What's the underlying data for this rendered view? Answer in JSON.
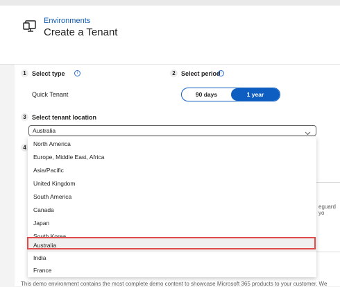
{
  "header": {
    "breadcrumb": "Environments",
    "title": "Create a Tenant"
  },
  "step1": {
    "number": "1",
    "label": "Select type",
    "value": "Quick Tenant"
  },
  "step2": {
    "number": "2",
    "label": "Select period",
    "options": [
      "90 days",
      "1 year"
    ],
    "selected": "1 year"
  },
  "step3": {
    "number": "3",
    "label": "Select tenant location",
    "selected_value": "Australia"
  },
  "step4": {
    "number": "4"
  },
  "dropdown": {
    "options": [
      "North America",
      "Europe, Middle East, Africa",
      "Asia/Pacific",
      "United Kingdom",
      "South America",
      "Canada",
      "Japan",
      "South Korea",
      "Australia",
      "India",
      "France"
    ],
    "selected": "Australia"
  },
  "background": {
    "truncated_text": "eguard yo",
    "footer_text": "This demo environment contains the most complete demo content to showcase Microsoft 365 products to your customer. We"
  },
  "colors": {
    "accent": "#0e5ec2",
    "highlight_border": "#e24a4a",
    "link": "#0f5bb5"
  }
}
